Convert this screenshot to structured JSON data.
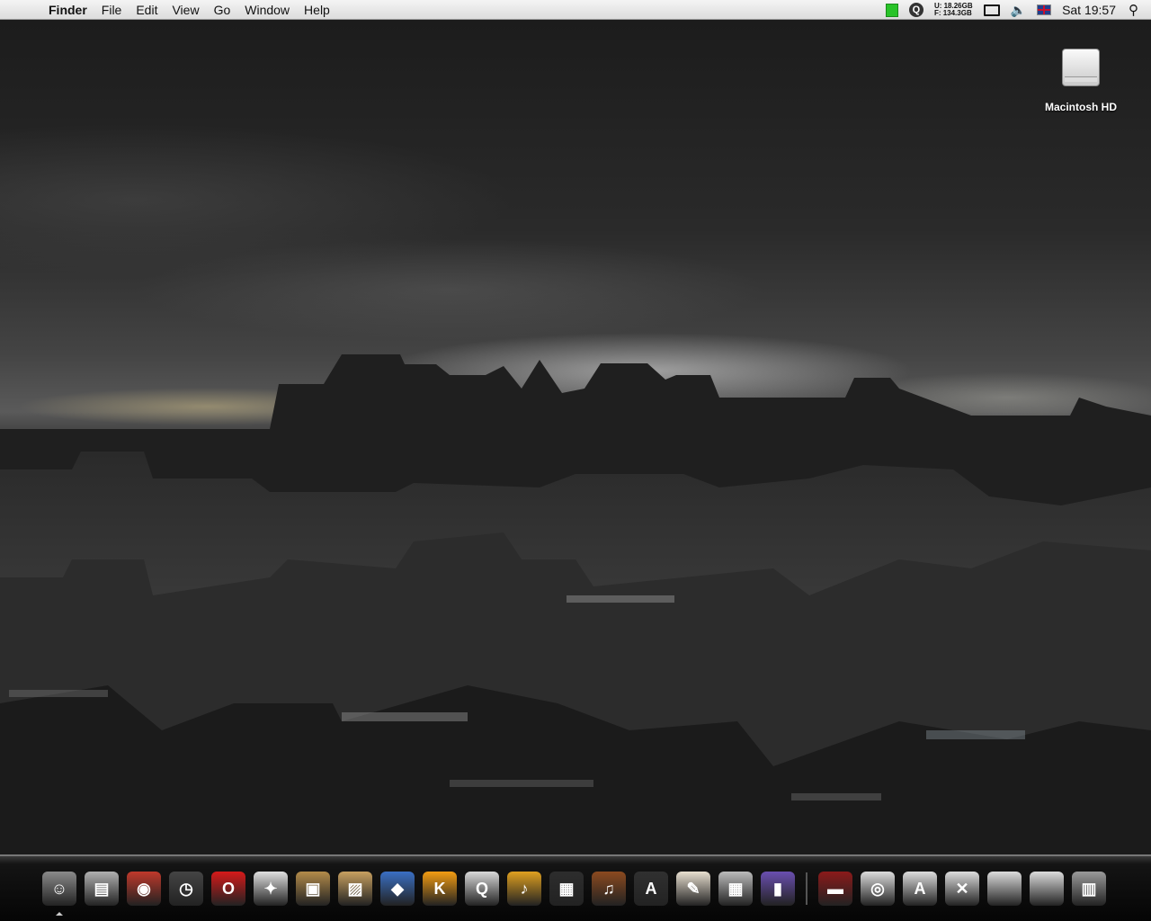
{
  "menubar": {
    "app_name": "Finder",
    "menus": [
      "File",
      "Edit",
      "View",
      "Go",
      "Window",
      "Help"
    ],
    "disk_used": "U: 18.26GB",
    "disk_free": "F: 134.3GB",
    "clock": "Sat 19:57"
  },
  "desktop": {
    "drive_label": "Macintosh HD"
  },
  "dock": {
    "items": [
      {
        "name": "finder-icon",
        "color": "#8a8a8a",
        "glyph": "☺",
        "running": true
      },
      {
        "name": "mac-pro-icon",
        "color": "#b0b0b0",
        "glyph": "▤",
        "running": false
      },
      {
        "name": "firefox-icon",
        "color": "#c0392b",
        "glyph": "◉",
        "running": false
      },
      {
        "name": "clock-icon",
        "color": "#444444",
        "glyph": "◷",
        "running": false
      },
      {
        "name": "opera-icon",
        "color": "#d61a1a",
        "glyph": "O",
        "running": false
      },
      {
        "name": "compass-icon",
        "color": "#e0e0e0",
        "glyph": "✦",
        "running": false
      },
      {
        "name": "photos-icon",
        "color": "#b38b4a",
        "glyph": "▣",
        "running": false
      },
      {
        "name": "preview-icon",
        "color": "#c8a060",
        "glyph": "▨",
        "running": false
      },
      {
        "name": "app-icon",
        "color": "#3a6fc4",
        "glyph": "◆",
        "running": false
      },
      {
        "name": "k-icon",
        "color": "#f39c12",
        "glyph": "K",
        "running": false
      },
      {
        "name": "quicktime-icon",
        "color": "#d8d8d8",
        "glyph": "Q",
        "running": false
      },
      {
        "name": "itunes-icon",
        "color": "#e0a020",
        "glyph": "♪",
        "running": false
      },
      {
        "name": "imovie-icon",
        "color": "#2d2d2d",
        "glyph": "▦",
        "running": false
      },
      {
        "name": "music-icon",
        "color": "#8b4a1f",
        "glyph": "♫",
        "running": false
      },
      {
        "name": "adium-icon",
        "color": "#303030",
        "glyph": "A",
        "running": false
      },
      {
        "name": "notes-icon",
        "color": "#e8e0d0",
        "glyph": "✎",
        "running": false
      },
      {
        "name": "calculator-icon",
        "color": "#bbbbbb",
        "glyph": "▦",
        "running": false
      },
      {
        "name": "book-icon",
        "color": "#6a4fb0",
        "glyph": "▮",
        "running": false
      },
      {
        "name": "separator",
        "color": "",
        "glyph": "",
        "running": false
      },
      {
        "name": "dictionary-icon",
        "color": "#8b1a1a",
        "glyph": "▬",
        "running": false
      },
      {
        "name": "downloads-folder-icon",
        "color": "#dcdcdc",
        "glyph": "◎",
        "running": false
      },
      {
        "name": "applications-folder-icon",
        "color": "#dcdcdc",
        "glyph": "A",
        "running": false
      },
      {
        "name": "utilities-folder-icon",
        "color": "#dcdcdc",
        "glyph": "✕",
        "running": false
      },
      {
        "name": "documents-folder-icon",
        "color": "#dcdcdc",
        "glyph": "",
        "running": false
      },
      {
        "name": "folder-icon",
        "color": "#dcdcdc",
        "glyph": "",
        "running": false
      },
      {
        "name": "trash-icon",
        "color": "#9a9a9a",
        "glyph": "▥",
        "running": false
      }
    ]
  }
}
